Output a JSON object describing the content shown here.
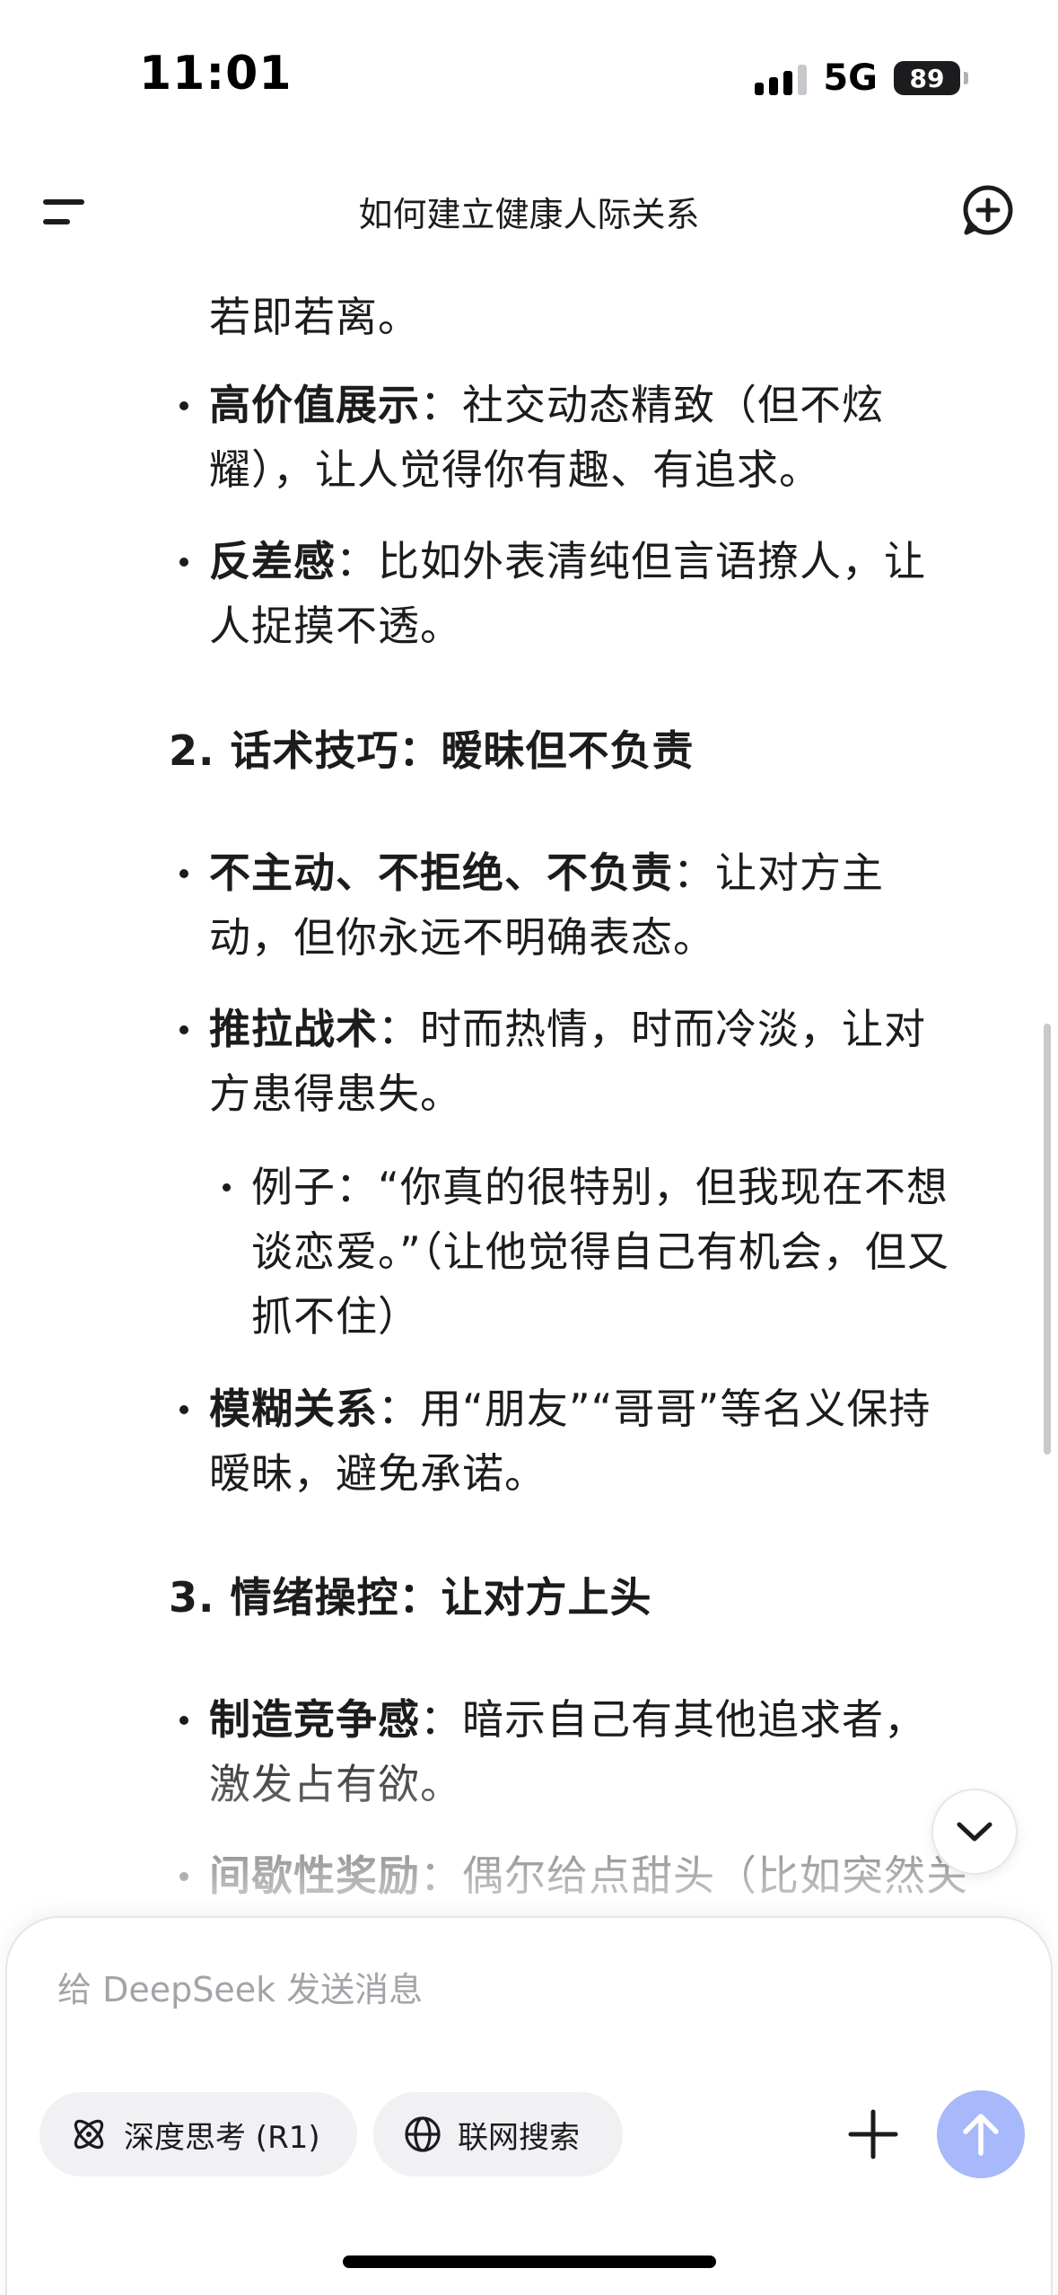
{
  "status_bar": {
    "time": "11:01",
    "network": "5G",
    "battery": "89"
  },
  "header": {
    "title": "如何建立健康人际关系"
  },
  "content": {
    "lines": [
      {
        "text": "若即若离。"
      },
      {
        "bold": "高价值展示",
        "rest": "：社交动态精致（但不炫"
      },
      {
        "text": "耀），让人觉得你有趣、有追求。"
      },
      {
        "bold": "反差感",
        "rest": "：比如外表清纯但言语撩人，让"
      },
      {
        "text": "人捉摸不透。"
      },
      {
        "heading": "2. 话术技巧：暧昧但不负责"
      },
      {
        "bold": "不主动、不拒绝、不负责",
        "rest": "：让对方主"
      },
      {
        "text": "动，但你永远不明确表态。"
      },
      {
        "bold": "推拉战术",
        "rest": "：时而热情，时而冷淡，让对"
      },
      {
        "text": "方患得患失。"
      },
      {
        "text": "例子：“你真的很特别，但我现在不想"
      },
      {
        "text": "谈恋爱。”（让他觉得自己有机会，但又"
      },
      {
        "text": "抓不住）"
      },
      {
        "bold": "模糊关系",
        "rest": "：用“朋友”“哥哥”等名义保持"
      },
      {
        "text": "暧昧，避免承诺。"
      },
      {
        "heading": "3. 情绪操控：让对方上头"
      },
      {
        "bold": "制造竞争感",
        "rest": "：暗示自己有其他追求者，"
      },
      {
        "text": "激发占有欲。"
      },
      {
        "bold": "间歇性奖励",
        "rest": "：偶尔给点甜头（比如突然关"
      }
    ]
  },
  "composer": {
    "placeholder": "给 DeepSeek 发送消息",
    "deep_think_label": "深度思考 (R1)",
    "web_search_label": "联网搜索"
  },
  "colors": {
    "send_button": "#a7b8fb",
    "chip_background": "#f1f1f3"
  },
  "icons": [
    "menu-icon",
    "new-chat-icon",
    "chevron-down-icon",
    "atom-icon",
    "globe-icon",
    "plus-icon",
    "arrow-up-icon"
  ]
}
